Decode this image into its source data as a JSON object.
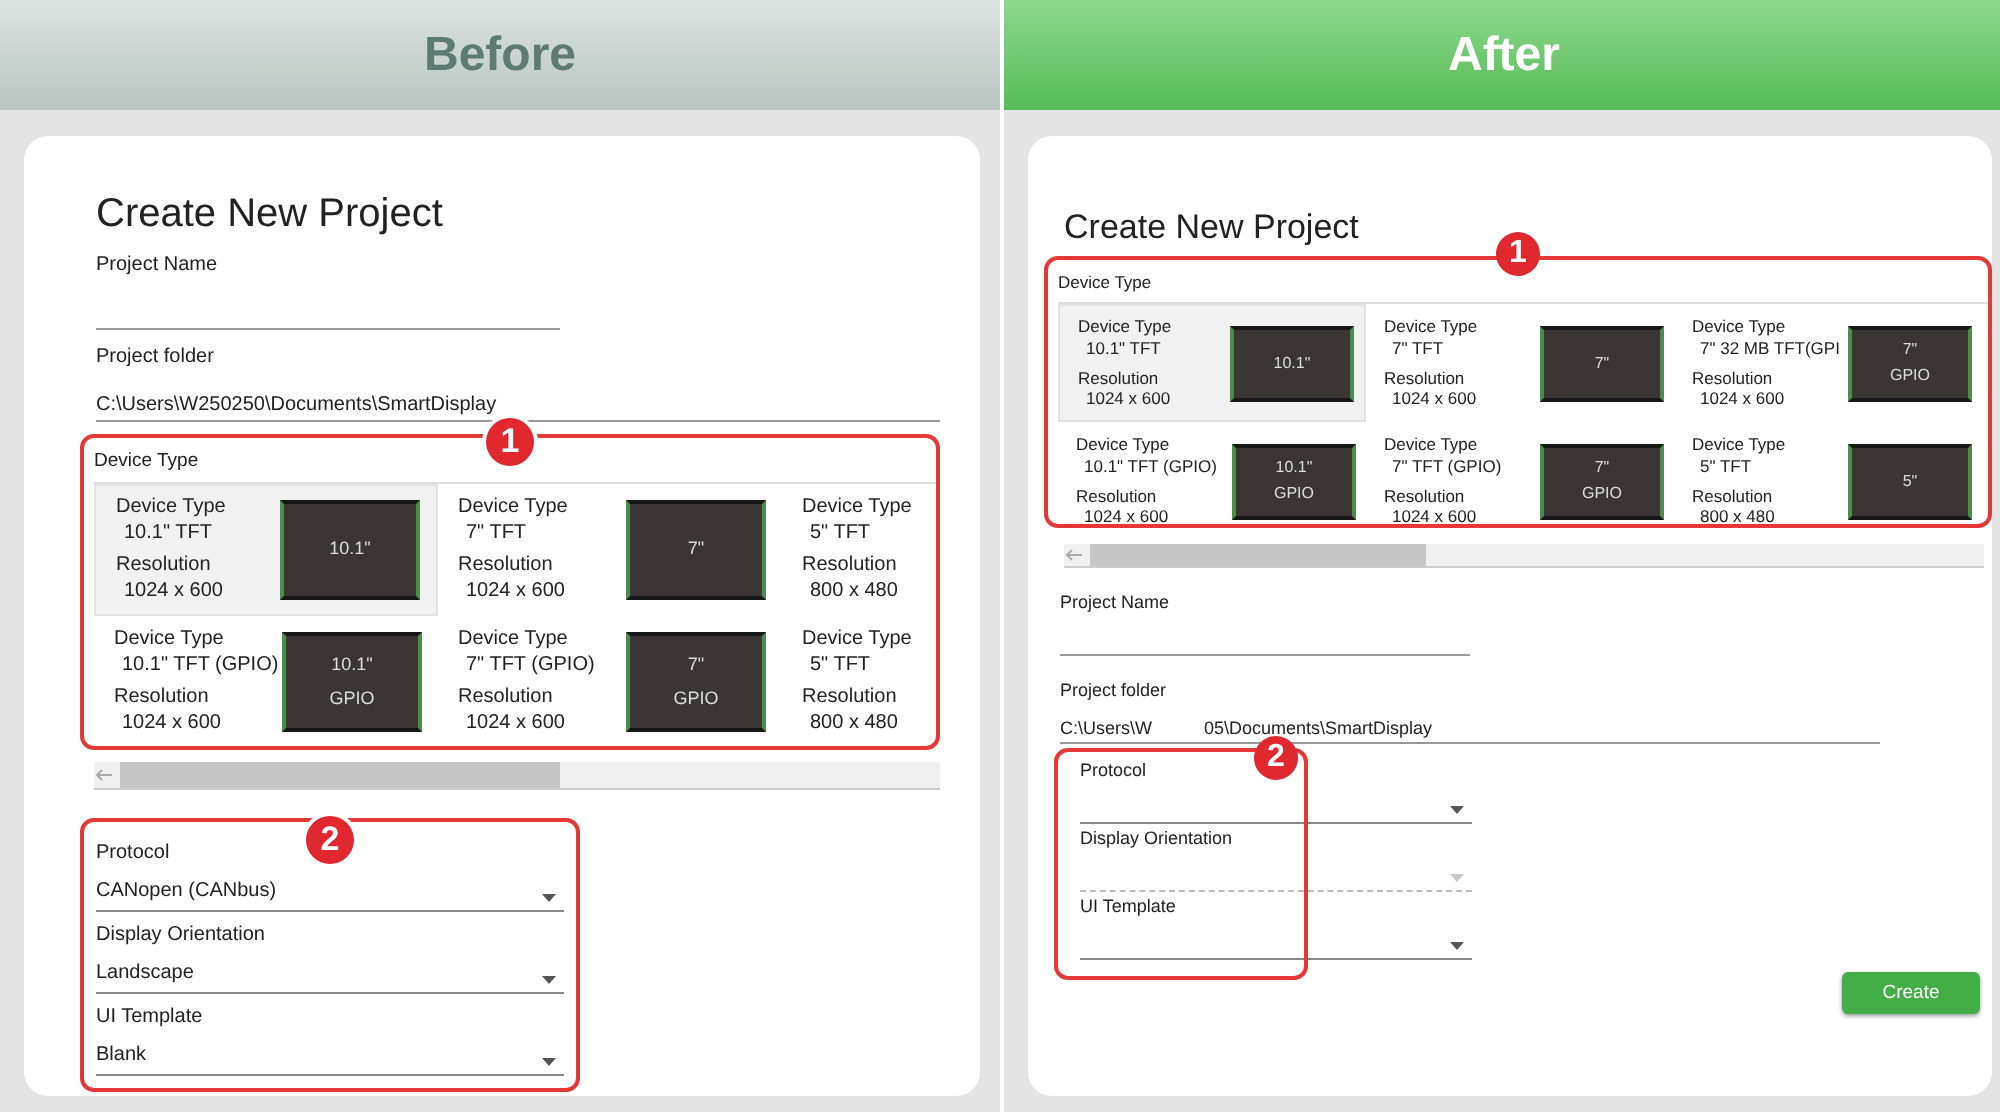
{
  "panels": [
    {
      "heading": "Before",
      "sections": [
        {
          "kind": "title",
          "text": "Create New Project"
        },
        {
          "kind": "text",
          "label": "Project Name"
        },
        {
          "kind": "folder",
          "label": "Project folder",
          "value_parts": [
            "C:\\Users\\W250250\\Documents\\SmartDisplay"
          ]
        },
        {
          "kind": "devices",
          "badge": "1",
          "label": "Device Type",
          "items": [
            {
              "kind": "full",
              "type_label": "Device Type",
              "type": "10.1\" TFT",
              "res_label": "Resolution",
              "resolution": "1024 x 600",
              "screen": [
                "10.1\""
              ],
              "selected": true
            },
            {
              "kind": "full",
              "type_label": "Device Type",
              "type": "7\" TFT",
              "res_label": "Resolution",
              "resolution": "1024 x 600",
              "screen": [
                "7\""
              ],
              "selected": false
            },
            {
              "kind": "cut",
              "type_label": "Device Type",
              "type": "5\" TFT",
              "res_label": "Resolution",
              "resolution": "800 x 480",
              "selected": false
            },
            {
              "kind": "full",
              "type_label": "Device Type",
              "type": "10.1\" TFT (GPIO)",
              "res_label": "Resolution",
              "resolution": "1024 x 600",
              "screen": [
                "10.1\"",
                "GPIO"
              ],
              "selected": false
            },
            {
              "kind": "full",
              "type_label": "Device Type",
              "type": "7\" TFT (GPIO)",
              "res_label": "Resolution",
              "resolution": "1024 x 600",
              "screen": [
                "7\"",
                "GPIO"
              ],
              "selected": false
            },
            {
              "kind": "cut",
              "type_label": "Device Type",
              "type": "5\" TFT",
              "res_label": "Resolution",
              "resolution": "800 x 480",
              "selected": false
            }
          ]
        },
        {
          "kind": "scrollbar"
        },
        {
          "kind": "settings",
          "badge": "2",
          "fields": [
            {
              "label": "Protocol",
              "value": "CANopen (CANbus)",
              "disabled": false
            },
            {
              "label": "Display Orientation",
              "value": "Landscape",
              "disabled": false
            },
            {
              "label": "UI Template",
              "value": "Blank",
              "disabled": false
            }
          ]
        }
      ]
    },
    {
      "heading": "After",
      "sections": [
        {
          "kind": "title",
          "text": "Create New Project"
        },
        {
          "kind": "devices",
          "badge": "1",
          "label": "Device Type",
          "items": [
            {
              "type_label": "Device Type",
              "type": "10.1\" TFT",
              "res_label": "Resolution",
              "resolution": "1024 x 600",
              "screen": [
                "10.1\""
              ],
              "selected": true
            },
            {
              "type_label": "Device Type",
              "type": "7\" TFT",
              "res_label": "Resolution",
              "resolution": "1024 x 600",
              "screen": [
                "7\""
              ],
              "selected": false
            },
            {
              "type_label": "Device Type",
              "type": "7\" 32 MB TFT(GPI",
              "res_label": "Resolution",
              "resolution": "1024 x 600",
              "screen": [
                "7\"",
                "GPIO"
              ],
              "selected": false
            },
            {
              "type_label": "Device Type",
              "type": "10.1\" TFT (GPIO)",
              "res_label": "Resolution",
              "resolution": "1024 x 600",
              "screen": [
                "10.1\"",
                "GPIO"
              ],
              "selected": false
            },
            {
              "type_label": "Device Type",
              "type": "7\" TFT (GPIO)",
              "res_label": "Resolution",
              "resolution": "1024 x 600",
              "screen": [
                "7\"",
                "GPIO"
              ],
              "selected": false
            },
            {
              "type_label": "Device Type",
              "type": "5\" TFT",
              "res_label": "Resolution",
              "resolution": "800 x 480",
              "screen": [
                "5\""
              ],
              "selected": false
            }
          ]
        },
        {
          "kind": "scrollbar"
        },
        {
          "kind": "text",
          "label": "Project Name"
        },
        {
          "kind": "folder",
          "label": "Project folder",
          "value_parts": [
            "C:\\Users\\W",
            "05\\Documents\\SmartDisplay"
          ]
        },
        {
          "kind": "settings",
          "badge": "2",
          "fields": [
            {
              "label": "Protocol",
              "disabled": false
            },
            {
              "label": "Display Orientation",
              "disabled": true
            },
            {
              "label": "UI Template",
              "disabled": false
            }
          ]
        },
        {
          "kind": "button",
          "label": "Create"
        }
      ]
    }
  ]
}
